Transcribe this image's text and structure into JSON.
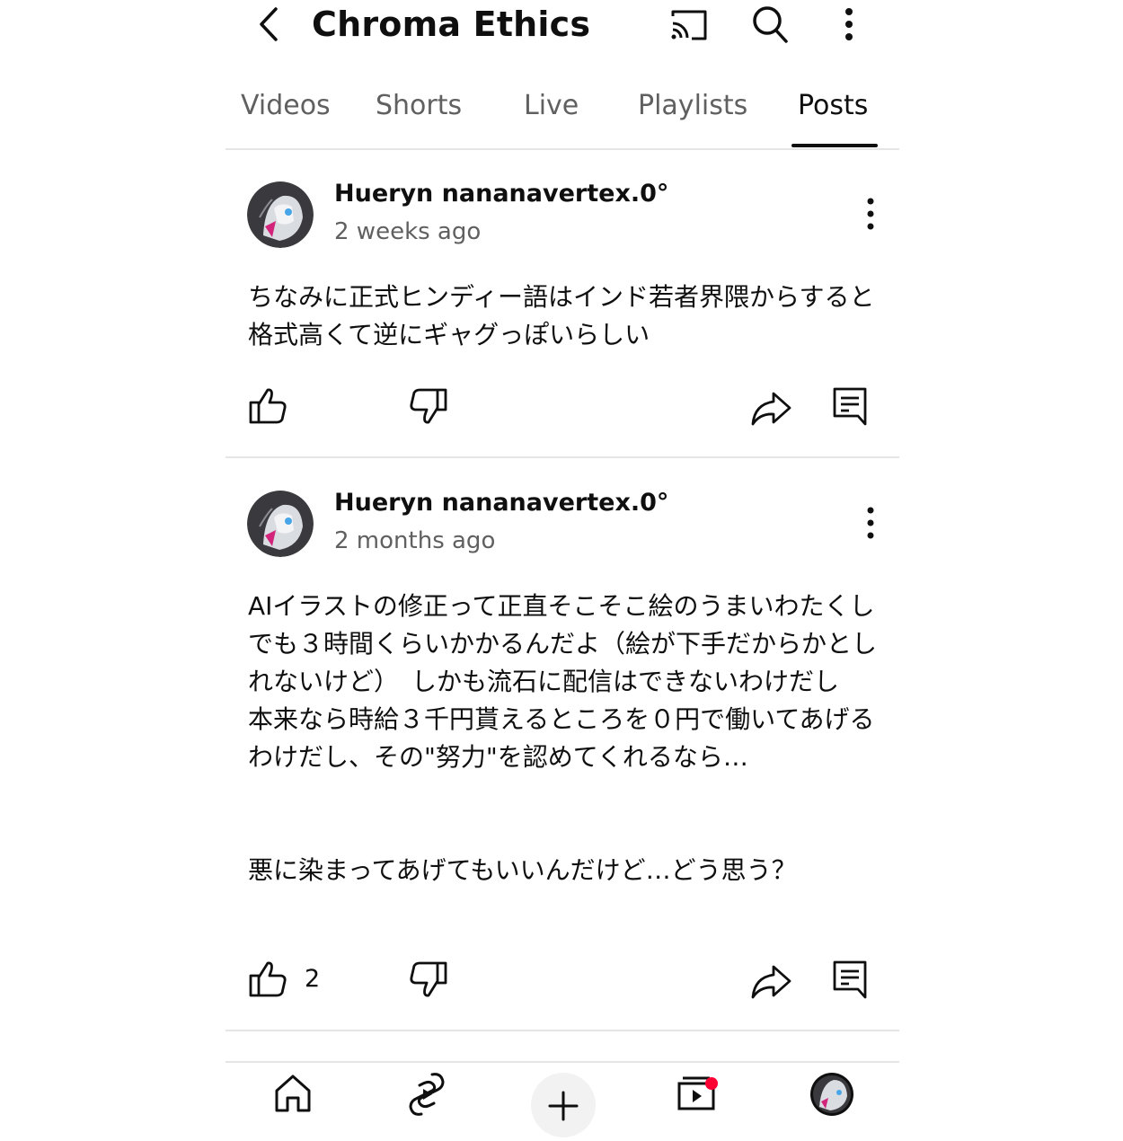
{
  "header": {
    "title": "Chroma Ethics",
    "icons": [
      "chevron-left-icon",
      "cast-icon",
      "search-icon",
      "more-vertical-icon"
    ]
  },
  "tabs": [
    {
      "label": "Videos",
      "active": false
    },
    {
      "label": "Shorts",
      "active": false
    },
    {
      "label": "Live",
      "active": false
    },
    {
      "label": "Playlists",
      "active": false
    },
    {
      "label": "Posts",
      "active": true
    }
  ],
  "posts": [
    {
      "author": "Hueryn nananavertex.0°",
      "time": "2 weeks ago",
      "text": "ちなみに正式ヒンディー語はインド若者界隈からすると格式高くて逆にギャグっぽいらしい",
      "likes": ""
    },
    {
      "author": "Hueryn nananavertex.0°",
      "time": "2 months ago",
      "text": "AIイラストの修正って正直そこそこ絵のうまいわたくしでも３時間くらいかかるんだよ（絵が下手だからかとしれないけど）　しかも流石に配信はできないわけだし　本来なら時給３千円貰えるところを０円で働いてあげるわけだし、その\"努力\"を認めてくれるなら…\n\n\n悪に染まってあげてもいいんだけど…どう思う？",
      "likes": "2"
    }
  ],
  "bottom_nav": {
    "items": [
      "home-icon",
      "shorts-icon",
      "create-icon",
      "subscriptions-icon",
      "you-avatar"
    ],
    "notification_color": "#ff0033"
  },
  "colors": {
    "text_primary": "#0f0f0f",
    "text_secondary": "#606060",
    "divider": "#e5e5e5"
  }
}
